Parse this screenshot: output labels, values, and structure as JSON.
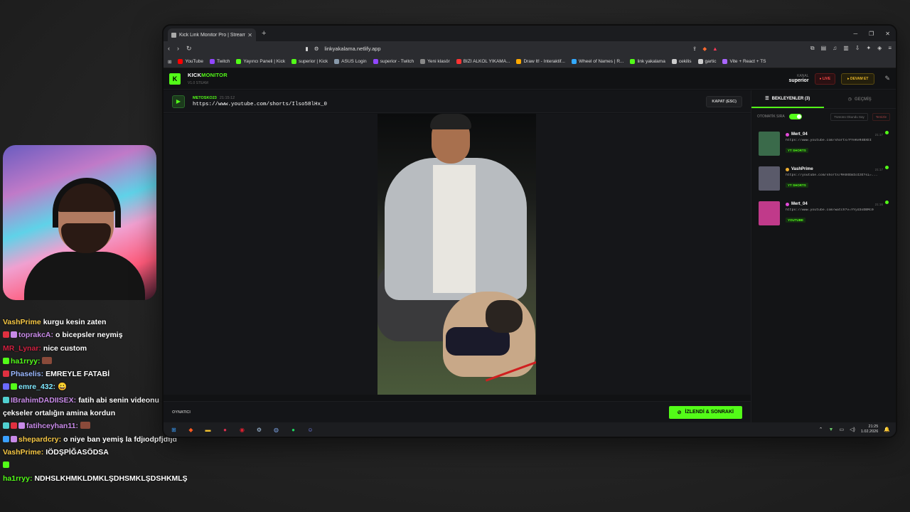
{
  "browser": {
    "tab_title": "Kick Link Monitor Pro | Stream",
    "url": "linkyakalama.netlify.app",
    "bookmarks": [
      {
        "label": "YouTube",
        "color": "#ff0000"
      },
      {
        "label": "Twitch",
        "color": "#9146ff"
      },
      {
        "label": "Yayıncı Paneli | Kick",
        "color": "#53fc18"
      },
      {
        "label": "superior | Kick",
        "color": "#53fc18"
      },
      {
        "label": "ASUS Login",
        "color": "#8899aa"
      },
      {
        "label": "superior - Twitch",
        "color": "#9146ff"
      },
      {
        "label": "Yeni klasör",
        "color": "#888888"
      },
      {
        "label": "BIZI ALKOL YIKAMA...",
        "color": "#ff3333"
      },
      {
        "label": "Draw It! - Interaktif...",
        "color": "#ffaa00"
      },
      {
        "label": "Wheel of Names | R...",
        "color": "#33aaff"
      },
      {
        "label": "link yakalama",
        "color": "#53fc18"
      },
      {
        "label": "cekilis",
        "color": "#cccccc"
      },
      {
        "label": "gartic",
        "color": "#cccccc"
      },
      {
        "label": "Vite + React + TS",
        "color": "#aa66ff"
      }
    ]
  },
  "app": {
    "brand_kick": "KICK",
    "brand_monitor": "MONITOR",
    "version": "V1.0 STEAM",
    "kanal_label": "KANAL",
    "kanal_name": "superior",
    "live_label": "● LIVE",
    "devam_label": "▸ DEVAM ET",
    "now_playing": {
      "user": "METOSKO23",
      "time": "21:15:12",
      "url": "https://www.youtube.com/shorts/Ilso58lHx_0"
    },
    "kapat_label": "KAPAT (ESC)",
    "footer_label": "OYNATICI",
    "next_label": "İZLENDİ & SONRAKİ",
    "sidebar": {
      "tab_waiting": "BEKLEYENLER (3)",
      "tab_history": "GEÇMİŞ",
      "auto_label": "OTOMATİK SIRA",
      "mark_all": "Tümünü Okundu Say",
      "clear": "Temizle"
    },
    "queue": [
      {
        "user": "Mert_04",
        "dot": "#e24ad8",
        "time": "21:17",
        "url": "https://www.youtube.com/shorts/FYeKeR4BXEI",
        "type": "YT SHORTS",
        "thumb": "#3a6a4a"
      },
      {
        "user": "VashPrime",
        "dot": "#f0b030",
        "time": "21:17",
        "url": "https://youtube.com/shorts/MA9XEmIoIzE?si=...",
        "type": "YT SHORTS",
        "thumb": "#5a5a6a"
      },
      {
        "user": "Mert_04",
        "dot": "#e24ad8",
        "time": "21:16",
        "url": "https://www.youtube.com/watch?v=YYyd3oDBMc0",
        "type": "YOUTUBE",
        "thumb": "#c03a8a"
      }
    ]
  },
  "taskbar": {
    "time": "21:25",
    "date": "1.02.2026"
  },
  "chat": [
    {
      "user": "VashPrime",
      "color": "#f6c744",
      "msg": "kurgu kesin zaten",
      "badges": []
    },
    {
      "user": "toprakcA:",
      "color": "#c88ae8",
      "msg": "o bicepsler neymiş",
      "badges": [
        "#e03040",
        "#c88ae8"
      ]
    },
    {
      "user": "MR_Lynar:",
      "color": "#d02040",
      "msg": "nice custom",
      "badges": []
    },
    {
      "user": "ha1rryy:",
      "color": "#53fc18",
      "msg": "",
      "badges": [
        "#53fc18"
      ],
      "emote": true
    },
    {
      "user": "Phaselis:",
      "color": "#9ab8ff",
      "msg": "EMREYLE FATABİ",
      "badges": [
        "#e03040"
      ]
    },
    {
      "user": "emre_432:",
      "color": "#80e8ff",
      "msg": "😀",
      "badges": [
        "#6a6aff",
        "#53fc18"
      ]
    },
    {
      "user": "IBrahimDADIISEX:",
      "color": "#c88ae8",
      "msg": "fatih abi senin videonu çekseler ortalığın amina kordun",
      "badges": [
        "#50d0d0"
      ],
      "wrap": true
    },
    {
      "user": "fatihceyhan11:",
      "color": "#c88ae8",
      "msg": "",
      "badges": [
        "#50d0d0",
        "#e03040",
        "#c88ae8"
      ],
      "emote": true
    },
    {
      "user": "shepardcry:",
      "color": "#f6c744",
      "msg": "o niye ban yemiş la fdjıodpfjdfjd",
      "badges": [
        "#3aa0ff",
        "#c88ae8"
      ],
      "wrap": true
    },
    {
      "user": "VashPrime:",
      "color": "#f6c744",
      "msg": "IÖDŞPİĞASÖDSA",
      "badges": []
    },
    {
      "user": "ha1rryy:",
      "color": "#53fc18",
      "msg": "NDHSLKHMKLDMKLŞDHSMKLŞDSHKMLŞŞKMLDHSDH",
      "badges": [
        "#53fc18"
      ],
      "wrap": true
    }
  ]
}
